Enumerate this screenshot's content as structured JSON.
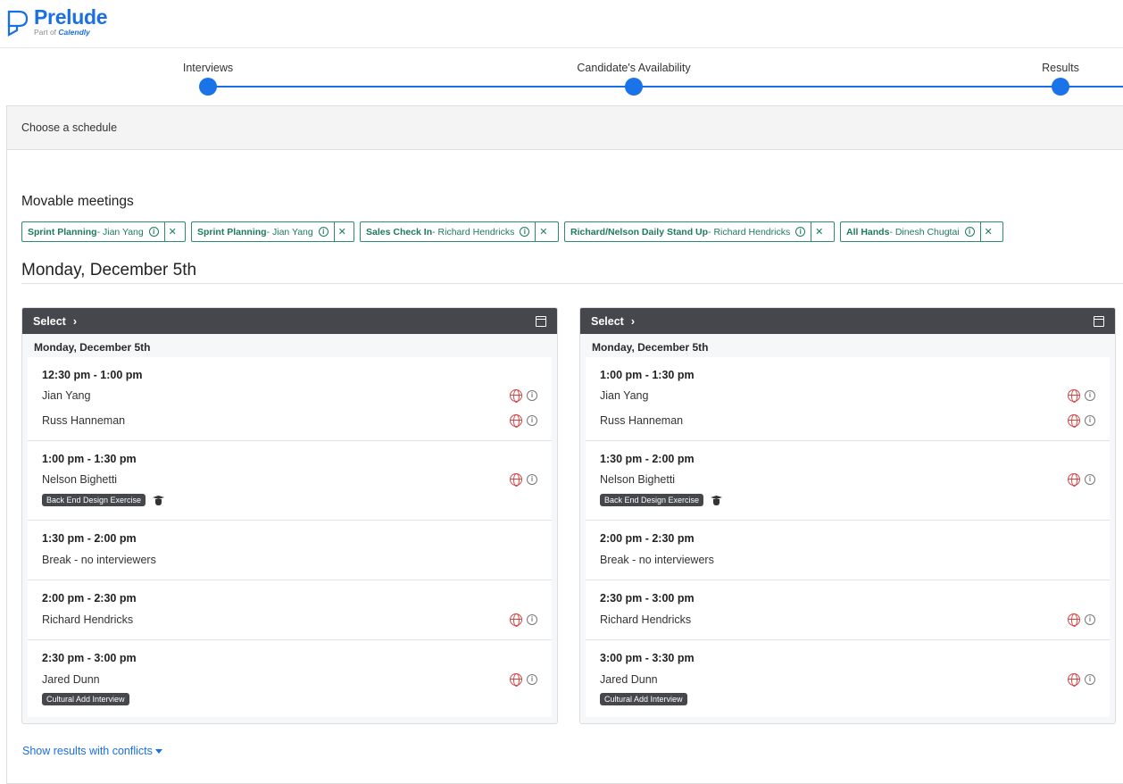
{
  "brand": {
    "name": "Prelude",
    "sub_prefix": "Part of",
    "sub_brand": "Calendly",
    "color": "#1a6ee6"
  },
  "stepper": {
    "steps": [
      {
        "label": "Interviews"
      },
      {
        "label": "Candidate's Availability"
      },
      {
        "label": "Results"
      }
    ]
  },
  "panel": {
    "title": "Choose a schedule"
  },
  "movable": {
    "title": "Movable meetings",
    "chips": [
      {
        "name": "Sprint Planning",
        "person": " - Jian Yang"
      },
      {
        "name": "Sprint Planning",
        "person": " - Jian Yang"
      },
      {
        "name": "Sales Check In",
        "person": " - Richard Hendricks"
      },
      {
        "name": "Richard/Nelson Daily Stand Up",
        "person": " - Richard Hendricks"
      },
      {
        "name": "All Hands",
        "person": " - Dinesh Chugtai"
      }
    ]
  },
  "day_title": "Monday, December 5th",
  "schedules": [
    {
      "select_label": "Select",
      "date": "Monday, December 5th",
      "slots": [
        {
          "time": "12:30 pm - 1:00 pm",
          "people": [
            "Jian Yang",
            "Russ Hanneman"
          ]
        },
        {
          "time": "1:00 pm - 1:30 pm",
          "people": [
            "Nelson Bighetti"
          ],
          "tag": "Back End Design Exercise"
        },
        {
          "time": "1:30 pm - 2:00 pm",
          "break": "Break - no interviewers"
        },
        {
          "time": "2:00 pm - 2:30 pm",
          "people": [
            "Richard Hendricks"
          ]
        },
        {
          "time": "2:30 pm - 3:00 pm",
          "people": [
            "Jared Dunn"
          ],
          "tag": "Cultural Add Interview"
        }
      ]
    },
    {
      "select_label": "Select",
      "date": "Monday, December 5th",
      "slots": [
        {
          "time": "1:00 pm - 1:30 pm",
          "people": [
            "Jian Yang",
            "Russ Hanneman"
          ]
        },
        {
          "time": "1:30 pm - 2:00 pm",
          "people": [
            "Nelson Bighetti"
          ],
          "tag": "Back End Design Exercise"
        },
        {
          "time": "2:00 pm - 2:30 pm",
          "break": "Break - no interviewers"
        },
        {
          "time": "2:30 pm - 3:00 pm",
          "people": [
            "Richard Hendricks"
          ]
        },
        {
          "time": "3:00 pm - 3:30 pm",
          "people": [
            "Jared Dunn"
          ],
          "tag": "Cultural Add Interview"
        }
      ]
    }
  ],
  "conflicts_link": "Show results with conflicts"
}
